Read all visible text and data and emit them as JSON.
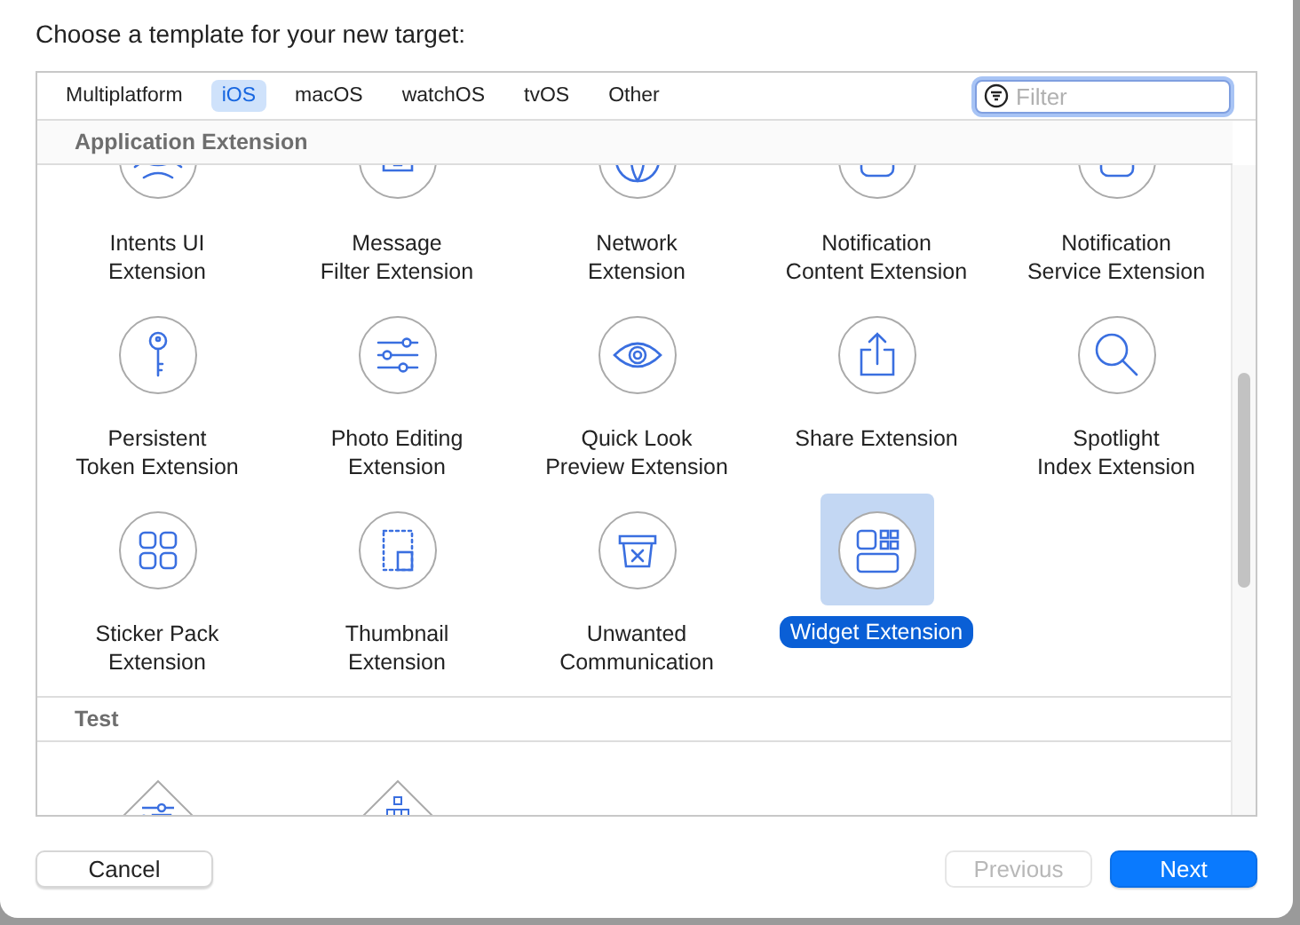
{
  "dialog": {
    "title": "Choose a template for your new target:"
  },
  "tabs": [
    {
      "label": "Multiplatform",
      "selected": false
    },
    {
      "label": "iOS",
      "selected": true
    },
    {
      "label": "macOS",
      "selected": false
    },
    {
      "label": "watchOS",
      "selected": false
    },
    {
      "label": "tvOS",
      "selected": false
    },
    {
      "label": "Other",
      "selected": false
    }
  ],
  "filter": {
    "placeholder": "Filter"
  },
  "sections": [
    {
      "title": "Application Extension",
      "items": [
        {
          "label": "Intents UI\nExtension",
          "selected": false
        },
        {
          "label": "Message\nFilter Extension",
          "selected": false
        },
        {
          "label": "Network\nExtension",
          "selected": false
        },
        {
          "label": "Notification\nContent Extension",
          "selected": false
        },
        {
          "label": "Notification\nService Extension",
          "selected": false
        },
        {
          "label": "Persistent\nToken Extension",
          "selected": false
        },
        {
          "label": "Photo Editing\nExtension",
          "selected": false
        },
        {
          "label": "Quick Look\nPreview Extension",
          "selected": false
        },
        {
          "label": "Share Extension",
          "selected": false
        },
        {
          "label": "Spotlight\nIndex Extension",
          "selected": false
        },
        {
          "label": "Sticker Pack\nExtension",
          "selected": false
        },
        {
          "label": "Thumbnail\nExtension",
          "selected": false
        },
        {
          "label": "Unwanted\nCommunication",
          "selected": false
        },
        {
          "label": "Widget Extension",
          "selected": true
        }
      ]
    },
    {
      "title": "Test",
      "items": [
        {
          "selected": false
        },
        {
          "selected": false
        }
      ]
    }
  ],
  "buttons": [
    {
      "label": "Cancel",
      "disabled": false,
      "primary": false
    },
    {
      "label": "Previous",
      "disabled": true,
      "primary": false
    },
    {
      "label": "Next",
      "disabled": false,
      "primary": true
    }
  ]
}
